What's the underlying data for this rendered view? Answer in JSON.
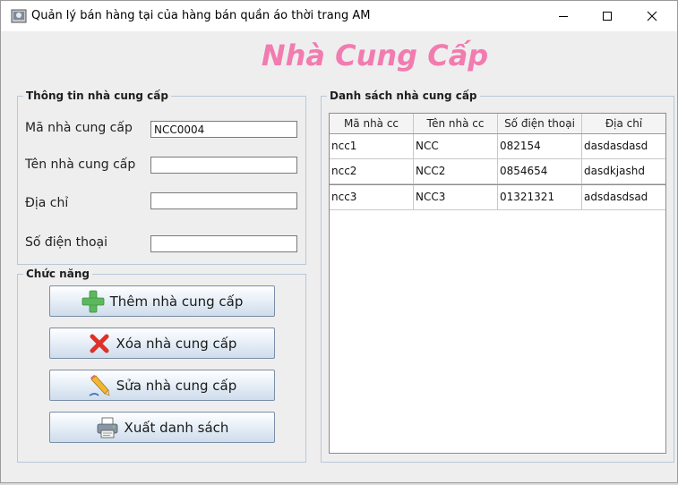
{
  "window": {
    "title": "Quản lý bán hàng tại của hàng bán quần áo thời trang AM",
    "controls": [
      "minimize-icon",
      "maximize-icon",
      "close-icon"
    ]
  },
  "heading": "Nhà Cung Cấp",
  "info_panel": {
    "legend": "Thông tin nhà cung cấp",
    "fields": [
      {
        "label": "Mã nhà cung cấp",
        "value": "NCC0004"
      },
      {
        "label": "Tên nhà cung cấp",
        "value": ""
      },
      {
        "label": "Địa chỉ",
        "value": ""
      },
      {
        "label": "Số điện thoại",
        "value": ""
      }
    ]
  },
  "function_panel": {
    "legend": "Chức năng",
    "buttons": [
      {
        "label": "Thêm nhà cung cấp",
        "icon": "plus-icon"
      },
      {
        "label": "Xóa nhà cung cấp",
        "icon": "delete-x-icon"
      },
      {
        "label": "Sửa nhà cung cấp",
        "icon": "pencil-icon"
      },
      {
        "label": "Xuất danh sách",
        "icon": "printer-icon"
      }
    ]
  },
  "list_panel": {
    "legend": "Danh sách nhà cung cấp",
    "columns": [
      "Mã nhà cc",
      "Tên nhà cc",
      "Số điện thoại",
      "Địa chỉ"
    ],
    "rows": [
      [
        "ncc1",
        "NCC",
        "082154",
        "dasdasdasd"
      ],
      [
        "ncc2",
        "NCC2",
        "0854654",
        "dasdkjashd"
      ],
      [
        "ncc3",
        "NCC3",
        "01321321",
        "adsdasdsad"
      ]
    ]
  },
  "colors": {
    "heading": "#f27bb0",
    "plus": "#5cb85c",
    "delete": "#e0302a"
  }
}
